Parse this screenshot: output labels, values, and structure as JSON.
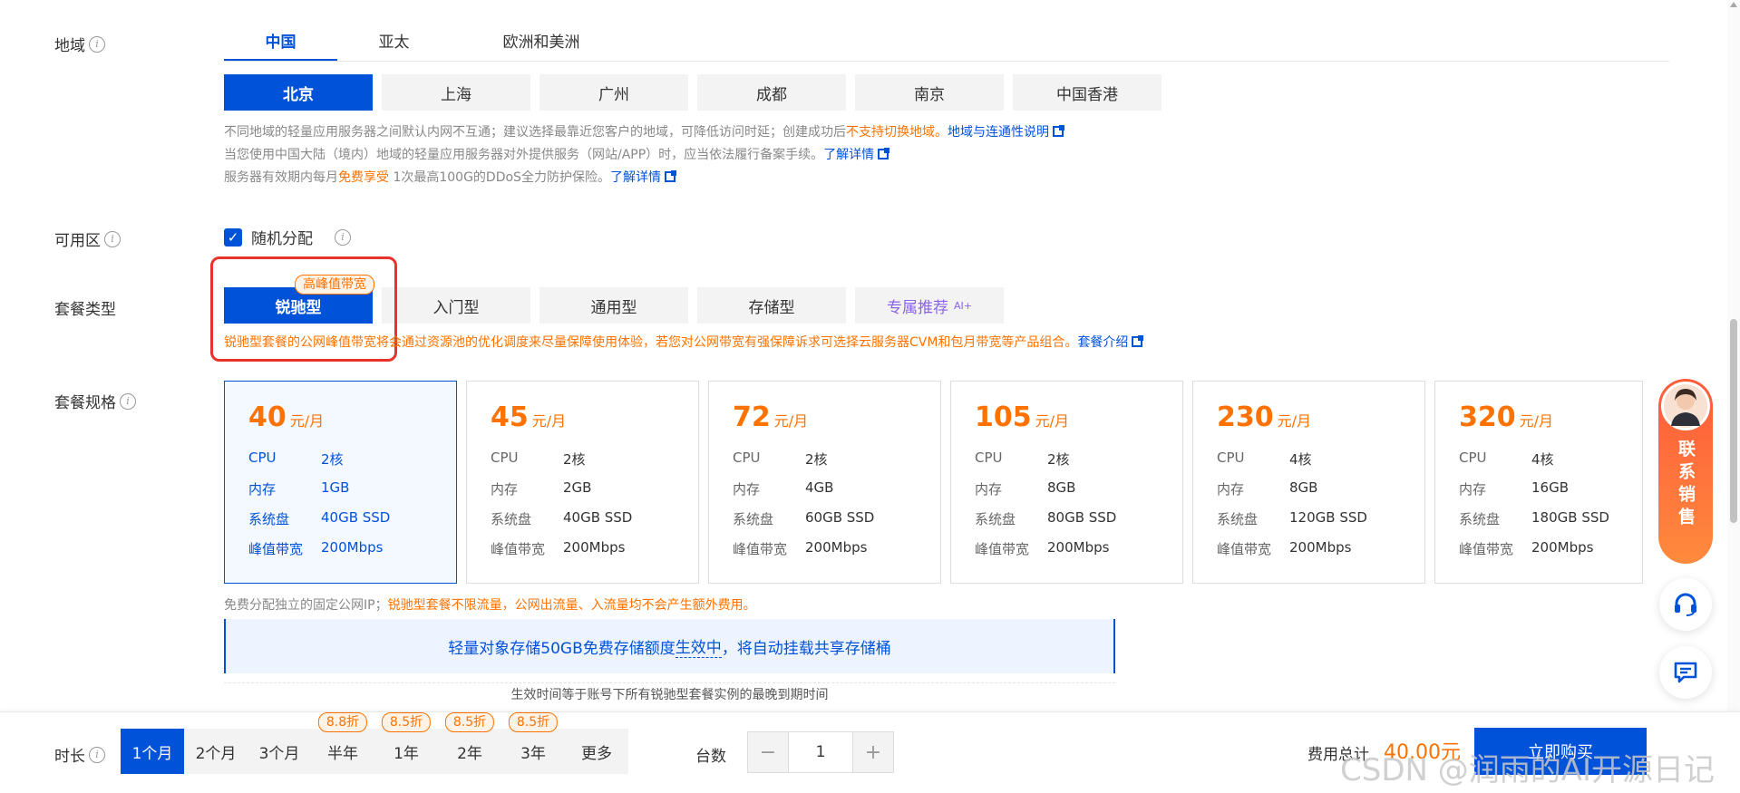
{
  "region": {
    "label": "地域",
    "tabs": [
      "中国",
      "亚太",
      "欧洲和美洲"
    ],
    "active_tab": 0,
    "cities": [
      "北京",
      "上海",
      "广州",
      "成都",
      "南京",
      "中国香港"
    ],
    "active_city": 0,
    "notes": {
      "line1_a": "不同地域的轻量应用服务器之间默认内网不互通；建议选择最靠近您客户的地域，可降低访问时延；创建成功后",
      "line1_b": "不支持切换地域。",
      "line1_link": "地域与连通性说明",
      "line2_a": "当您使用中国大陆（境内）地域的轻量应用服务器对外提供服务（网站/APP）时，应当依法履行备案手续。",
      "line2_link": "了解详情",
      "line3_a": "服务器有效期内每月",
      "line3_b": "免费享受",
      "line3_c": " 1次最高100G的DDoS全力防护保险。",
      "line3_link": "了解详情"
    }
  },
  "zone": {
    "label": "可用区",
    "checkbox_label": "随机分配",
    "checked": true
  },
  "package_type": {
    "label": "套餐类型",
    "badge": "高峰值带宽",
    "types": [
      "锐驰型",
      "入门型",
      "通用型",
      "存储型",
      "专属推荐"
    ],
    "ai_tag": "AI+",
    "active": 0,
    "note": "锐驰型套餐的公网峰值带宽将会通过资源池的优化调度来尽量保障使用体验，若您对公网带宽有强保障诉求可选择云服务器CVM和包月带宽等产品组合。",
    "note_link": "套餐介绍"
  },
  "package_spec": {
    "label": "套餐规格",
    "price_unit": "元/月",
    "keys": {
      "cpu": "CPU",
      "mem": "内存",
      "disk": "系统盘",
      "bw": "峰值带宽"
    },
    "cards": [
      {
        "price": "40",
        "cpu": "2核",
        "mem": "1GB",
        "disk": "40GB SSD",
        "bw": "200Mbps"
      },
      {
        "price": "45",
        "cpu": "2核",
        "mem": "2GB",
        "disk": "40GB SSD",
        "bw": "200Mbps"
      },
      {
        "price": "72",
        "cpu": "2核",
        "mem": "4GB",
        "disk": "60GB SSD",
        "bw": "200Mbps"
      },
      {
        "price": "105",
        "cpu": "2核",
        "mem": "8GB",
        "disk": "80GB SSD",
        "bw": "200Mbps"
      },
      {
        "price": "230",
        "cpu": "4核",
        "mem": "8GB",
        "disk": "120GB SSD",
        "bw": "200Mbps"
      },
      {
        "price": "320",
        "cpu": "4核",
        "mem": "16GB",
        "disk": "180GB SSD",
        "bw": "200Mbps"
      }
    ],
    "active": 0,
    "ip_note_a": "免费分配独立的固定公网IP；",
    "ip_note_b": "锐驰型套餐不限流量，公网出流量、入流量均不会产生额外费用。",
    "storage_banner_a": "轻量对象存储50GB免费存储额度",
    "storage_banner_b": "生效中",
    "storage_banner_c": "，将自动挂载共享存储桶",
    "effective_note": "生效时间等于账号下所有锐驰型套餐实例的最晚到期时间"
  },
  "bottom_bar": {
    "duration_label": "时长",
    "durations": [
      {
        "label": "1个月",
        "badge": ""
      },
      {
        "label": "2个月",
        "badge": ""
      },
      {
        "label": "3个月",
        "badge": ""
      },
      {
        "label": "半年",
        "badge": "8.8折"
      },
      {
        "label": "1年",
        "badge": "8.5折"
      },
      {
        "label": "2年",
        "badge": "8.5折"
      },
      {
        "label": "3年",
        "badge": "8.5折"
      },
      {
        "label": "更多",
        "badge": ""
      }
    ],
    "active_duration": 0,
    "count_label": "台数",
    "count_value": "1",
    "minus": "−",
    "plus": "+",
    "total_label": "费用总计",
    "total_value": "40.00元",
    "buy_label": "立即购买"
  },
  "float_panel": {
    "sales_text": "联系销售"
  },
  "watermark": "CSDN @润雨的AI开源日记",
  "colors": {
    "primary": "#0052d9",
    "accent": "#ff7200",
    "highlight_box": "#e8332b"
  }
}
